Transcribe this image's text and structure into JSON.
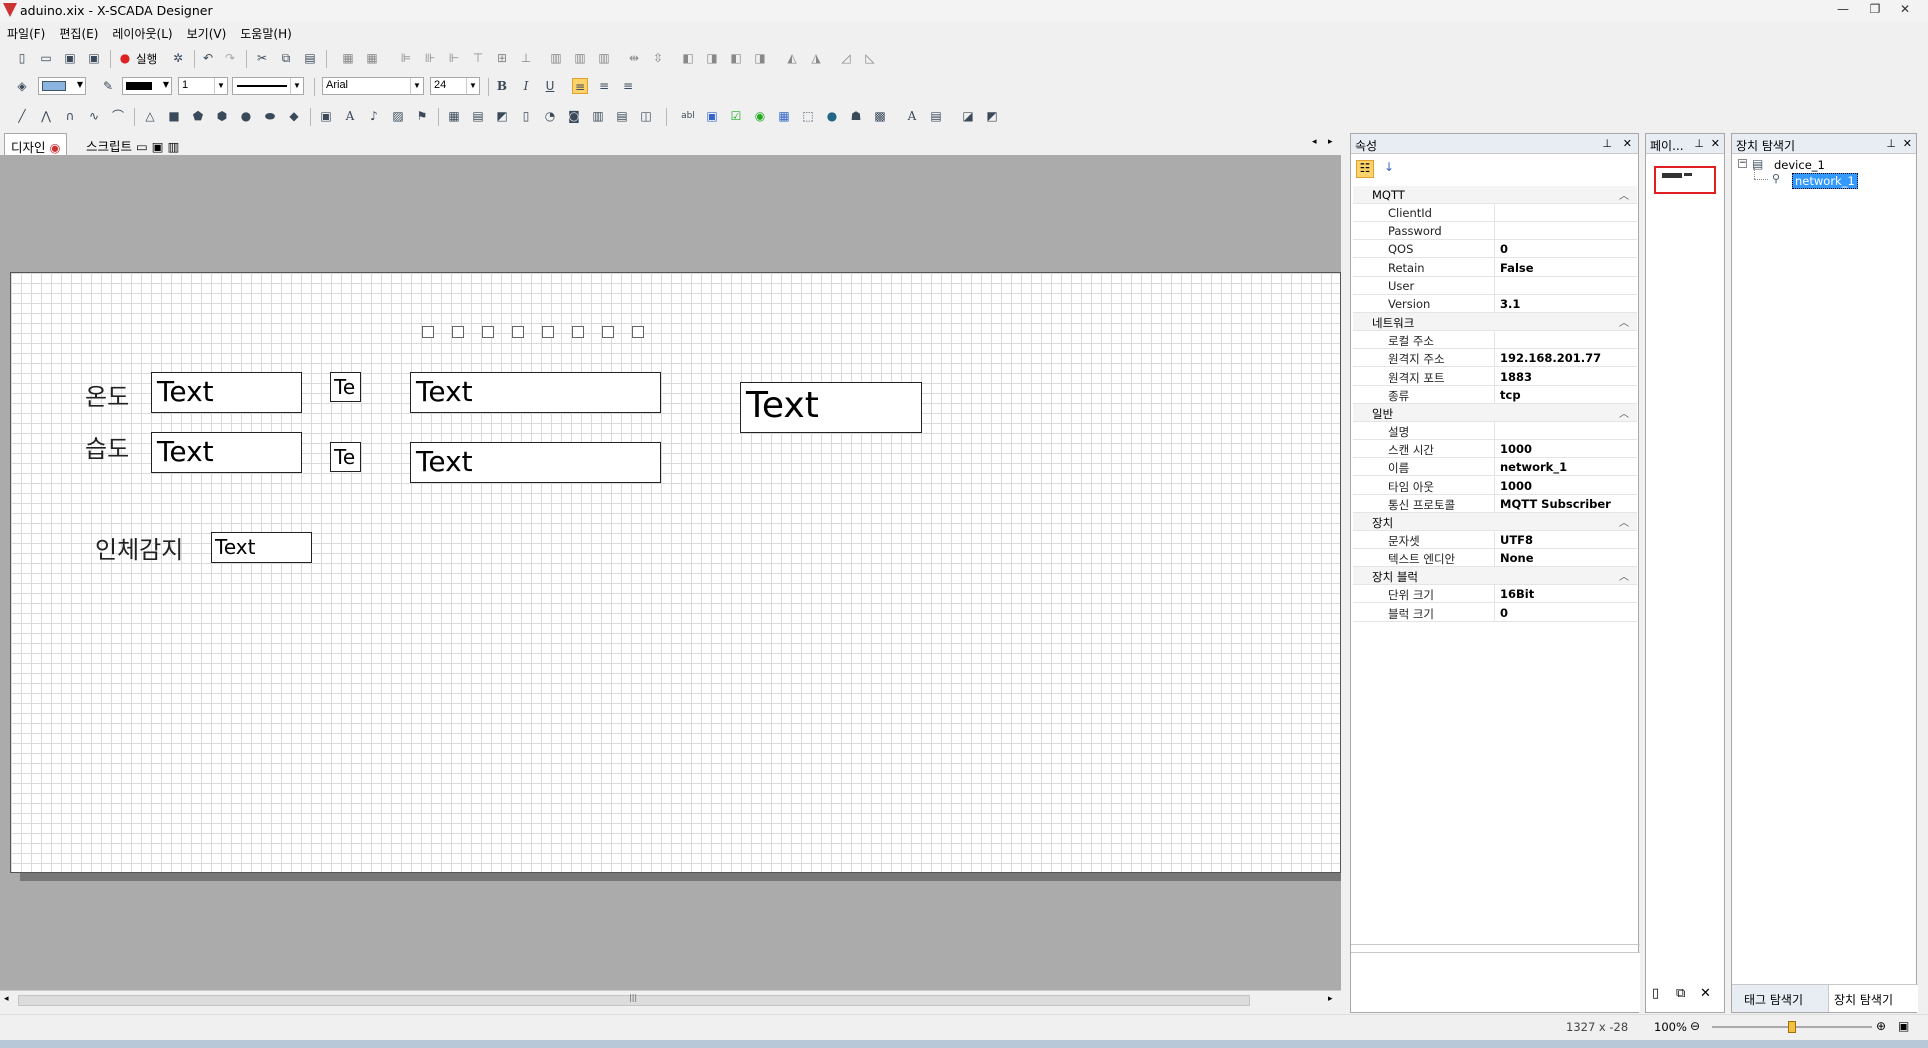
{
  "window": {
    "title": "aduino.xix - X-SCADA Designer"
  },
  "menu": [
    "파일(F)",
    "편집(E)",
    "레이아웃(L)",
    "보기(V)",
    "도움말(H)"
  ],
  "toolbar": {
    "run_label": "실행",
    "line_width": "1",
    "font_name": "Arial",
    "font_size": "24"
  },
  "tabs": {
    "design": "디자인",
    "script": "스크립트"
  },
  "canvas": {
    "labels": {
      "temp": "온도",
      "humidity": "습도",
      "motion": "인체감지"
    },
    "text_boxes": [
      "Text",
      "Te",
      "Text",
      "Text",
      "Text",
      "Te",
      "Text",
      "Text"
    ]
  },
  "properties": {
    "title": "속성",
    "categories": [
      {
        "name": "MQTT",
        "rows": [
          [
            "ClientId",
            ""
          ],
          [
            "Password",
            ""
          ],
          [
            "QOS",
            "0"
          ],
          [
            "Retain",
            "False"
          ],
          [
            "User",
            ""
          ],
          [
            "Version",
            "3.1"
          ]
        ]
      },
      {
        "name": "네트워크",
        "rows": [
          [
            "로컬 주소",
            ""
          ],
          [
            "원격지 주소",
            "192.168.201.77"
          ],
          [
            "원격지 포트",
            "1883"
          ],
          [
            "종류",
            "tcp"
          ]
        ]
      },
      {
        "name": "일반",
        "rows": [
          [
            "설명",
            ""
          ],
          [
            "스캔 시간",
            "1000"
          ],
          [
            "이름",
            "network_1"
          ],
          [
            "타임 아웃",
            "1000"
          ],
          [
            "통신 프로토콜",
            "MQTT Subscriber"
          ]
        ]
      },
      {
        "name": "장치",
        "rows": [
          [
            "문자셋",
            "UTF8"
          ],
          [
            "텍스트 엔디안",
            "None"
          ]
        ]
      },
      {
        "name": "장치 블럭",
        "rows": [
          [
            "단위 크기",
            "16Bit"
          ],
          [
            "블럭 크기",
            "0"
          ]
        ]
      }
    ]
  },
  "page_panel": {
    "title": "페이..."
  },
  "device_explorer": {
    "title": "장치 탐색기",
    "tree": [
      "device_1",
      "network_1"
    ],
    "bottom_tabs": [
      "태그 탐색기",
      "장치 탐색기"
    ]
  },
  "status": {
    "coords": "1327 x -28",
    "zoom": "100%"
  }
}
